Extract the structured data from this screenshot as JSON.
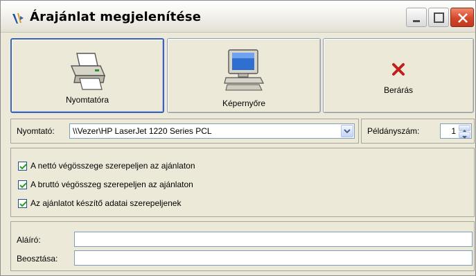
{
  "window": {
    "title": "Árajánlat megjelenítése"
  },
  "buttons": {
    "print": {
      "label": "Nyomtatóra",
      "icon": "printer-icon"
    },
    "screen": {
      "label": "Képernyőre",
      "icon": "monitor-icon"
    },
    "cancel": {
      "label": "Berárás",
      "icon": "close-x-icon"
    }
  },
  "printer": {
    "label": "Nyomtató:",
    "value": "\\\\Vezer\\HP LaserJet 1220 Series PCL"
  },
  "copies": {
    "label": "Példányszám:",
    "value": "1"
  },
  "options": [
    {
      "label": "A nettó végösszege szerepeljen az ajánlaton",
      "checked": true
    },
    {
      "label": "A bruttó végösszeg szerepeljen az ajánlaton",
      "checked": true
    },
    {
      "label": "Az ajánlatot készítő adatai szerepeljenek",
      "checked": true
    }
  ],
  "signer": {
    "label": "Aláíró:",
    "value": ""
  },
  "position": {
    "label": "Beosztása:",
    "value": ""
  },
  "colors": {
    "accent": "#3a63b8",
    "close": "#d4462a",
    "cancel_x": "#c0201c",
    "check": "#21a121"
  }
}
